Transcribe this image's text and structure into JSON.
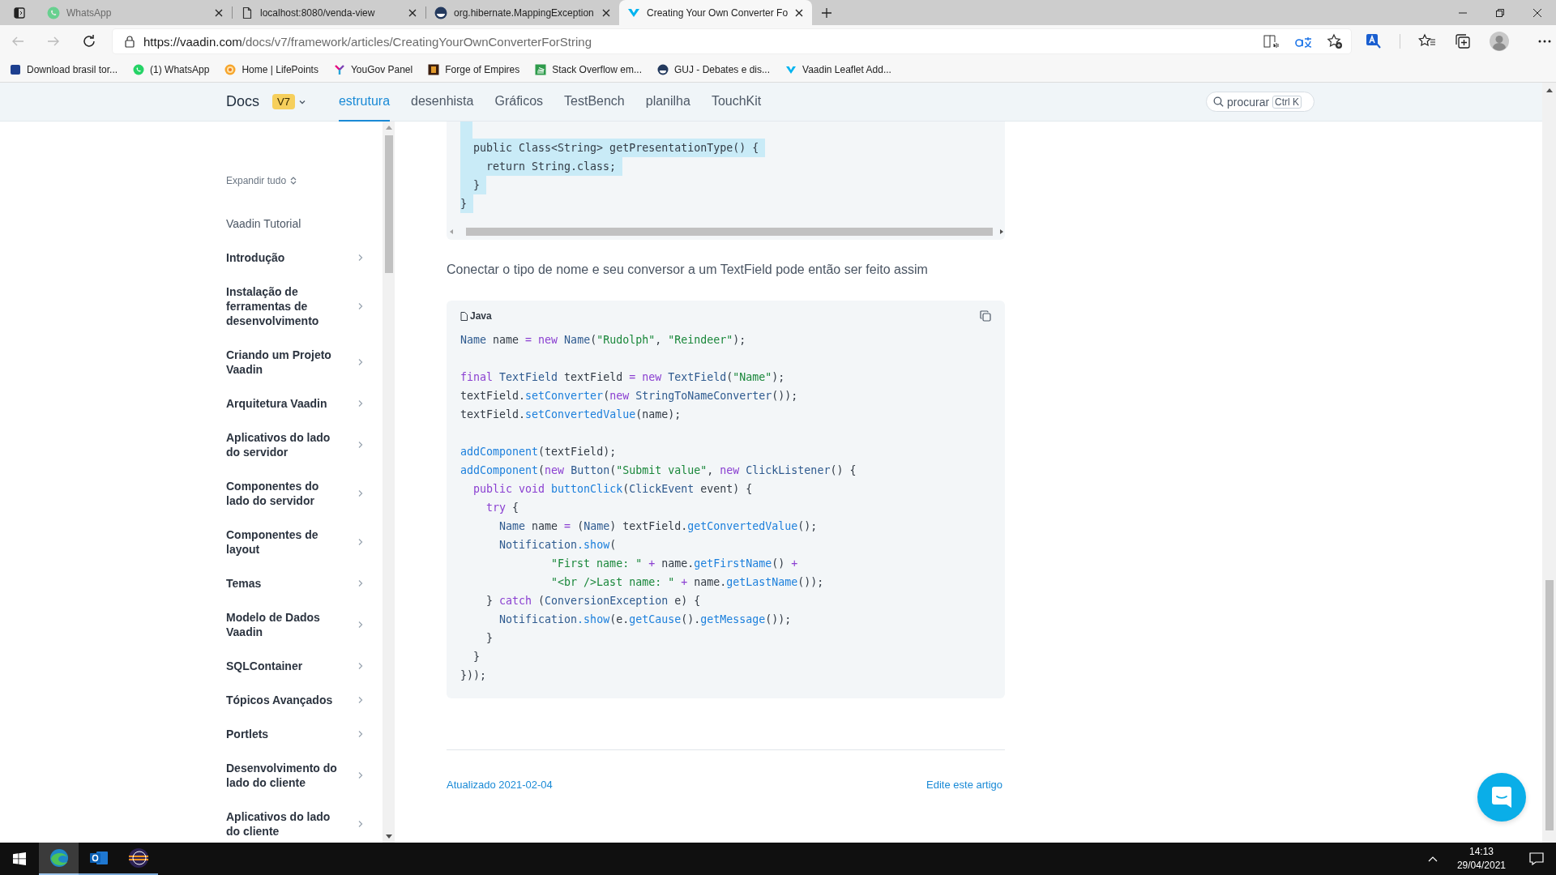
{
  "browser": {
    "tabs": [
      {
        "title": "WhatsApp",
        "selected": false,
        "sleeping": true
      },
      {
        "title": "localhost:8080/venda-view",
        "selected": false,
        "sleeping": false
      },
      {
        "title": "org.hibernate.MappingException",
        "selected": false,
        "sleeping": false
      },
      {
        "title": "Creating Your Own Converter Fo",
        "selected": true,
        "sleeping": false
      }
    ],
    "url": {
      "host": "https://vaadin.com",
      "path": "/docs/v7/framework/articles/CreatingYourOwnConverterForString"
    },
    "bookmarks": [
      {
        "label": "Download brasil tor..."
      },
      {
        "label": "(1) WhatsApp"
      },
      {
        "label": "Home | LifePoints"
      },
      {
        "label": "YouGov Panel"
      },
      {
        "label": "Forge of Empires"
      },
      {
        "label": "Stack Overflow em..."
      },
      {
        "label": "GUJ - Debates e dis..."
      },
      {
        "label": "Vaadin Leaflet Add..."
      }
    ]
  },
  "header": {
    "logo": "Docs",
    "version": "V7",
    "nav": [
      {
        "label": "estrutura",
        "selected": true
      },
      {
        "label": "desenhista",
        "selected": false
      },
      {
        "label": "Gráficos",
        "selected": false
      },
      {
        "label": "TestBench",
        "selected": false
      },
      {
        "label": "planilha",
        "selected": false
      },
      {
        "label": "TouchKit",
        "selected": false
      }
    ],
    "search": {
      "placeholder": "procurar",
      "shortcut": "Ctrl K"
    }
  },
  "sidebar": {
    "expand_all": "Expandir tudo",
    "items": [
      {
        "label": "Vaadin Tutorial",
        "kind": "link"
      },
      {
        "label": "Introdução",
        "kind": "section",
        "expanded": false
      },
      {
        "label": "Instalação de ferramentas de desenvolvimento",
        "kind": "section",
        "expanded": false
      },
      {
        "label": "Criando um Projeto Vaadin",
        "kind": "section",
        "expanded": false
      },
      {
        "label": "Arquitetura Vaadin",
        "kind": "section",
        "expanded": false
      },
      {
        "label": "Aplicativos do lado do servidor",
        "kind": "section",
        "expanded": false
      },
      {
        "label": "Componentes do lado do servidor",
        "kind": "section",
        "expanded": false
      },
      {
        "label": "Componentes de layout",
        "kind": "section",
        "expanded": false
      },
      {
        "label": "Temas",
        "kind": "section",
        "expanded": false
      },
      {
        "label": "Modelo de Dados Vaadin",
        "kind": "section",
        "expanded": false
      },
      {
        "label": "SQLContainer",
        "kind": "section",
        "expanded": false
      },
      {
        "label": "Tópicos Avançados",
        "kind": "section",
        "expanded": false
      },
      {
        "label": "Portlets",
        "kind": "section",
        "expanded": false
      },
      {
        "label": "Desenvolvimento do lado do cliente",
        "kind": "section",
        "expanded": false
      },
      {
        "label": "Aplicativos do lado do cliente",
        "kind": "section",
        "expanded": false
      }
    ]
  },
  "content": {
    "code_top": {
      "lines": [
        {
          "selected": true
        },
        {
          "text": "  public Class<String> getPresentationType() {",
          "selected": true
        },
        {
          "text": "    return String.class;",
          "selected": true
        },
        {
          "text": "  }",
          "selected": true
        },
        {
          "text": "}",
          "selected": true
        }
      ]
    },
    "paragraph": "Conectar o tipo de nome e seu conversor a um TextField pode então ser feito assim",
    "code": {
      "language": "Java",
      "lines": [
        {
          "kind": "code",
          "tokens": [
            {
              "kind": "type",
              "text": "Name"
            },
            {
              "kind": "plain",
              "text": " name "
            },
            {
              "kind": "keyword",
              "text": "= new"
            },
            {
              "kind": "type",
              "text": " Name"
            },
            {
              "kind": "plain",
              "text": "("
            },
            {
              "kind": "string",
              "text": "\"Rudolph\""
            },
            {
              "kind": "plain",
              "text": ", "
            },
            {
              "kind": "string",
              "text": "\"Reindeer\""
            },
            {
              "kind": "plain",
              "text": ");"
            }
          ]
        },
        {
          "kind": "blank"
        },
        {
          "kind": "code",
          "tokens": [
            {
              "kind": "keyword",
              "text": "final"
            },
            {
              "kind": "type",
              "text": " TextField"
            },
            {
              "kind": "plain",
              "text": " textField "
            },
            {
              "kind": "keyword",
              "text": "= new"
            },
            {
              "kind": "type",
              "text": " TextField"
            },
            {
              "kind": "plain",
              "text": "("
            },
            {
              "kind": "string",
              "text": "\"Name\""
            },
            {
              "kind": "plain",
              "text": ");"
            }
          ]
        },
        {
          "kind": "code",
          "tokens": [
            {
              "kind": "plain",
              "text": "textField."
            },
            {
              "kind": "method",
              "text": "setConverter"
            },
            {
              "kind": "plain",
              "text": "("
            },
            {
              "kind": "keyword",
              "text": "new"
            },
            {
              "kind": "type",
              "text": " StringToNameConverter"
            },
            {
              "kind": "plain",
              "text": "());"
            }
          ]
        },
        {
          "kind": "code",
          "tokens": [
            {
              "kind": "plain",
              "text": "textField."
            },
            {
              "kind": "method",
              "text": "setConvertedValue"
            },
            {
              "kind": "plain",
              "text": "(name);"
            }
          ]
        },
        {
          "kind": "blank"
        },
        {
          "kind": "code",
          "tokens": [
            {
              "kind": "method",
              "text": "addComponent"
            },
            {
              "kind": "plain",
              "text": "(textField);"
            }
          ]
        },
        {
          "kind": "code",
          "tokens": [
            {
              "kind": "method",
              "text": "addComponent"
            },
            {
              "kind": "plain",
              "text": "("
            },
            {
              "kind": "keyword",
              "text": "new"
            },
            {
              "kind": "type",
              "text": " Button"
            },
            {
              "kind": "plain",
              "text": "("
            },
            {
              "kind": "string",
              "text": "\"Submit value\""
            },
            {
              "kind": "plain",
              "text": ", "
            },
            {
              "kind": "keyword",
              "text": "new"
            },
            {
              "kind": "type",
              "text": " ClickListener"
            },
            {
              "kind": "plain",
              "text": "() {"
            }
          ]
        },
        {
          "kind": "code",
          "tokens": [
            {
              "kind": "keyword",
              "text": "  public void"
            },
            {
              "kind": "method",
              "text": " buttonClick"
            },
            {
              "kind": "plain",
              "text": "("
            },
            {
              "kind": "type",
              "text": "ClickEvent"
            },
            {
              "kind": "plain",
              "text": " event) {"
            }
          ]
        },
        {
          "kind": "code",
          "tokens": [
            {
              "kind": "keyword",
              "text": "    try"
            },
            {
              "kind": "plain",
              "text": " {"
            }
          ]
        },
        {
          "kind": "code",
          "tokens": [
            {
              "kind": "type",
              "text": "      Name"
            },
            {
              "kind": "plain",
              "text": " name "
            },
            {
              "kind": "keyword",
              "text": "="
            },
            {
              "kind": "plain",
              "text": " ("
            },
            {
              "kind": "type",
              "text": "Name"
            },
            {
              "kind": "plain",
              "text": ") textField."
            },
            {
              "kind": "method",
              "text": "getConvertedValue"
            },
            {
              "kind": "plain",
              "text": "();"
            }
          ]
        },
        {
          "kind": "code",
          "tokens": [
            {
              "kind": "type",
              "text": "      Notification"
            },
            {
              "kind": "method",
              "text": ".show"
            },
            {
              "kind": "plain",
              "text": "("
            }
          ]
        },
        {
          "kind": "code",
          "tokens": [
            {
              "kind": "string",
              "text": "              \"First name: \""
            },
            {
              "kind": "keyword",
              "text": " +"
            },
            {
              "kind": "plain",
              "text": " name."
            },
            {
              "kind": "method",
              "text": "getFirstName"
            },
            {
              "kind": "plain",
              "text": "()"
            },
            {
              "kind": "keyword",
              "text": " +"
            }
          ]
        },
        {
          "kind": "code",
          "tokens": [
            {
              "kind": "string",
              "text": "              \"<br />Last name: \""
            },
            {
              "kind": "keyword",
              "text": " +"
            },
            {
              "kind": "plain",
              "text": " name."
            },
            {
              "kind": "method",
              "text": "getLastName"
            },
            {
              "kind": "plain",
              "text": "());"
            }
          ]
        },
        {
          "kind": "code",
          "tokens": [
            {
              "kind": "plain",
              "text": "    }"
            },
            {
              "kind": "keyword",
              "text": " catch"
            },
            {
              "kind": "plain",
              "text": " ("
            },
            {
              "kind": "type",
              "text": "ConversionException"
            },
            {
              "kind": "plain",
              "text": " e) {"
            }
          ]
        },
        {
          "kind": "code",
          "tokens": [
            {
              "kind": "type",
              "text": "      Notification"
            },
            {
              "kind": "method",
              "text": ".show"
            },
            {
              "kind": "plain",
              "text": "(e."
            },
            {
              "kind": "method",
              "text": "getCause"
            },
            {
              "kind": "plain",
              "text": "()."
            },
            {
              "kind": "method",
              "text": "getMessage"
            },
            {
              "kind": "plain",
              "text": "());"
            }
          ]
        },
        {
          "kind": "code",
          "tokens": [
            {
              "kind": "plain",
              "text": "    }"
            }
          ]
        },
        {
          "kind": "code",
          "tokens": [
            {
              "kind": "plain",
              "text": "  }"
            }
          ]
        },
        {
          "kind": "code",
          "tokens": [
            {
              "kind": "plain",
              "text": "}));"
            }
          ]
        }
      ]
    },
    "footer": {
      "updated": "Atualizado 2021-02-04",
      "edit": "Edite este artigo"
    }
  },
  "taskbar": {
    "apps": [
      {
        "selected": true
      },
      {
        "selected": false
      },
      {
        "selected": false
      }
    ],
    "time": "14:13",
    "date": "29/04/2021"
  }
}
